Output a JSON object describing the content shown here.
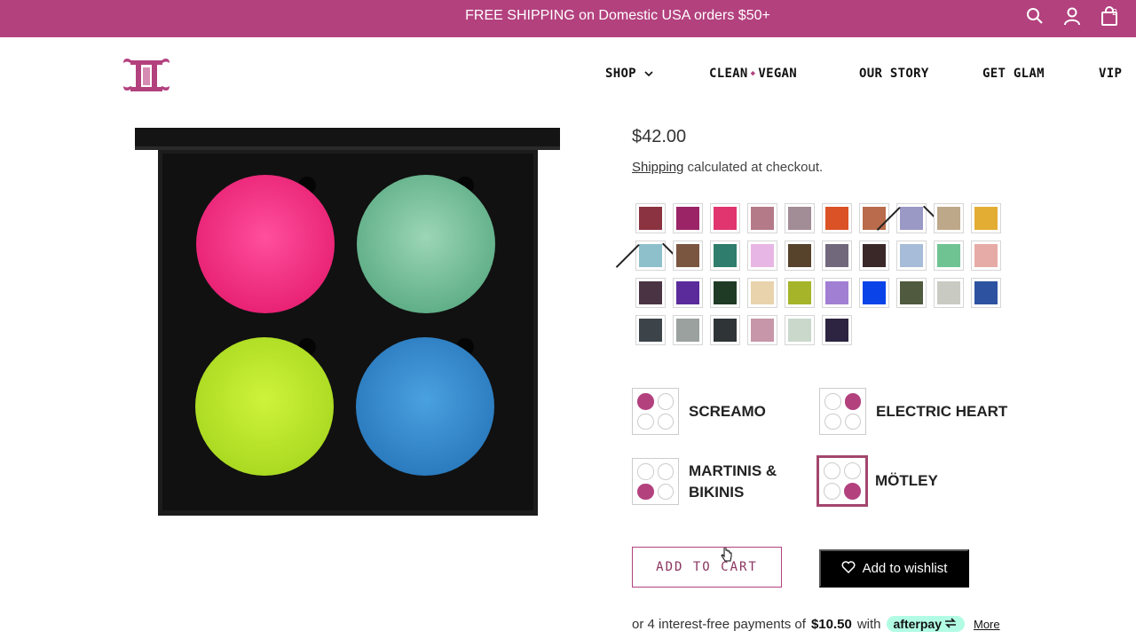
{
  "announcement": {
    "text": "FREE SHIPPING on Domestic USA orders $50+"
  },
  "header_icons": {
    "search": "search-icon",
    "account": "account-icon",
    "cart": "cart-icon",
    "cart_count": "2"
  },
  "nav": {
    "items": [
      {
        "label": "SHOP",
        "has_dropdown": true
      },
      {
        "label_a": "CLEAN",
        "separator": "◆",
        "label_b": "VEGAN"
      },
      {
        "label": "OUR STORY"
      },
      {
        "label": "GET GLAM"
      },
      {
        "label": "VIP"
      }
    ]
  },
  "product": {
    "price": "$42.00",
    "shipping_link": "Shipping",
    "shipping_text": " calculated at checkout.",
    "image_pans": [
      "#ee2a7e",
      "#6fbf97",
      "#b4e12a",
      "#2f86c8"
    ]
  },
  "swatches": [
    [
      "#8b3340",
      "#9b2467",
      "#e0356f",
      "#b47a88",
      "#a28c95",
      "#db5226",
      "#b96b4b",
      "#9a98c5:x",
      "#bea88a",
      "#e3ad34"
    ],
    [
      "#8ec0cc:x",
      "#7a5641",
      "#2f7d6c",
      "#e8b6e4",
      "#57432c",
      "#72687b",
      "#3a2828",
      "#a7bcd8",
      "#6fc393",
      "#e6aba6"
    ],
    [
      "#4a3444",
      "#5b2b9c",
      "#1f3b25",
      "#e9d3ac",
      "#a6b42a",
      "#a17fd3",
      "#0a43e8",
      "#4f5a3e",
      "#c9cbc3",
      "#2d52a0"
    ],
    [
      "#3d4449",
      "#9aa19e",
      "#2f3437",
      "#c796a8",
      "#c9d8cb",
      "#2c2440"
    ]
  ],
  "layouts": [
    {
      "label": "SCREAMO",
      "filled": 0,
      "selected": false
    },
    {
      "label": "ELECTRIC HEART",
      "filled": 1,
      "selected": false
    },
    {
      "label_1": "MARTINIS &",
      "label_2": "BIKINIS",
      "filled": 2,
      "selected": false
    },
    {
      "label": "MÖTLEY",
      "filled": 3,
      "selected": true
    }
  ],
  "actions": {
    "add_to_cart": "ADD TO CART",
    "wishlist": "Add to wishlist"
  },
  "afterpay": {
    "prefix": "or 4 interest-free payments of",
    "amount": "$10.50",
    "with": "with",
    "brand": "afterpay",
    "more": "More"
  },
  "colors": {
    "brand": "#b3417e"
  }
}
